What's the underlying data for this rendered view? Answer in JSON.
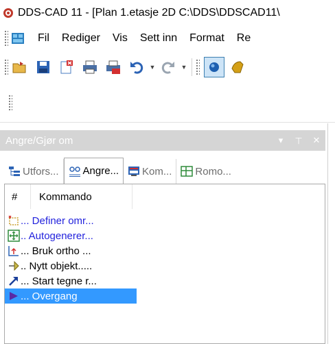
{
  "window": {
    "title": "DDS-CAD 11 - [Plan 1.etasje  2D  C:\\DDS\\DDSCAD11\\"
  },
  "menu": {
    "items": [
      "Fil",
      "Rediger",
      "Vis",
      "Sett inn",
      "Format",
      "Re"
    ]
  },
  "toolbar": {
    "icons": [
      "open-icon",
      "save-icon",
      "new-icon",
      "print-icon",
      "pdf-icon",
      "undo-icon",
      "redo-icon",
      "view-icon",
      "hand-icon"
    ]
  },
  "pane": {
    "title": "Angre/Gjør om",
    "dropdown_glyph": "▾",
    "pin_glyph": "⊥",
    "close_glyph": "✕",
    "tabs": [
      {
        "label": "Utfors...",
        "icon": "explorer-icon"
      },
      {
        "label": "Angre...",
        "icon": "undo-list-icon"
      },
      {
        "label": "Kom...",
        "icon": "command-icon"
      },
      {
        "label": "Romo...",
        "icon": "room-icon"
      }
    ],
    "columns": {
      "hash": "#",
      "command": "Kommando"
    },
    "rows": [
      {
        "text": "... Definer omr...",
        "icon": "define-area-icon",
        "color": "#2222dd",
        "selected": false
      },
      {
        "text": ".. Autogenerer...",
        "icon": "autogenerate-icon",
        "color": "#2222dd",
        "selected": false
      },
      {
        "text": "... Bruk ortho ...",
        "icon": "ortho-icon",
        "color": "#000000",
        "selected": false
      },
      {
        "text": ".. Nytt objekt.....",
        "icon": "new-object-icon",
        "color": "#000000",
        "selected": false
      },
      {
        "text": "... Start tegne r...",
        "icon": "start-draw-icon",
        "color": "#000000",
        "selected": false
      },
      {
        "text": "... Overgang",
        "icon": "transition-icon",
        "color": "#ffffff",
        "selected": true
      }
    ]
  },
  "colors": {
    "selection": "#3399ff",
    "header_bg": "#d5d5d5",
    "blue_text": "#2222dd"
  }
}
